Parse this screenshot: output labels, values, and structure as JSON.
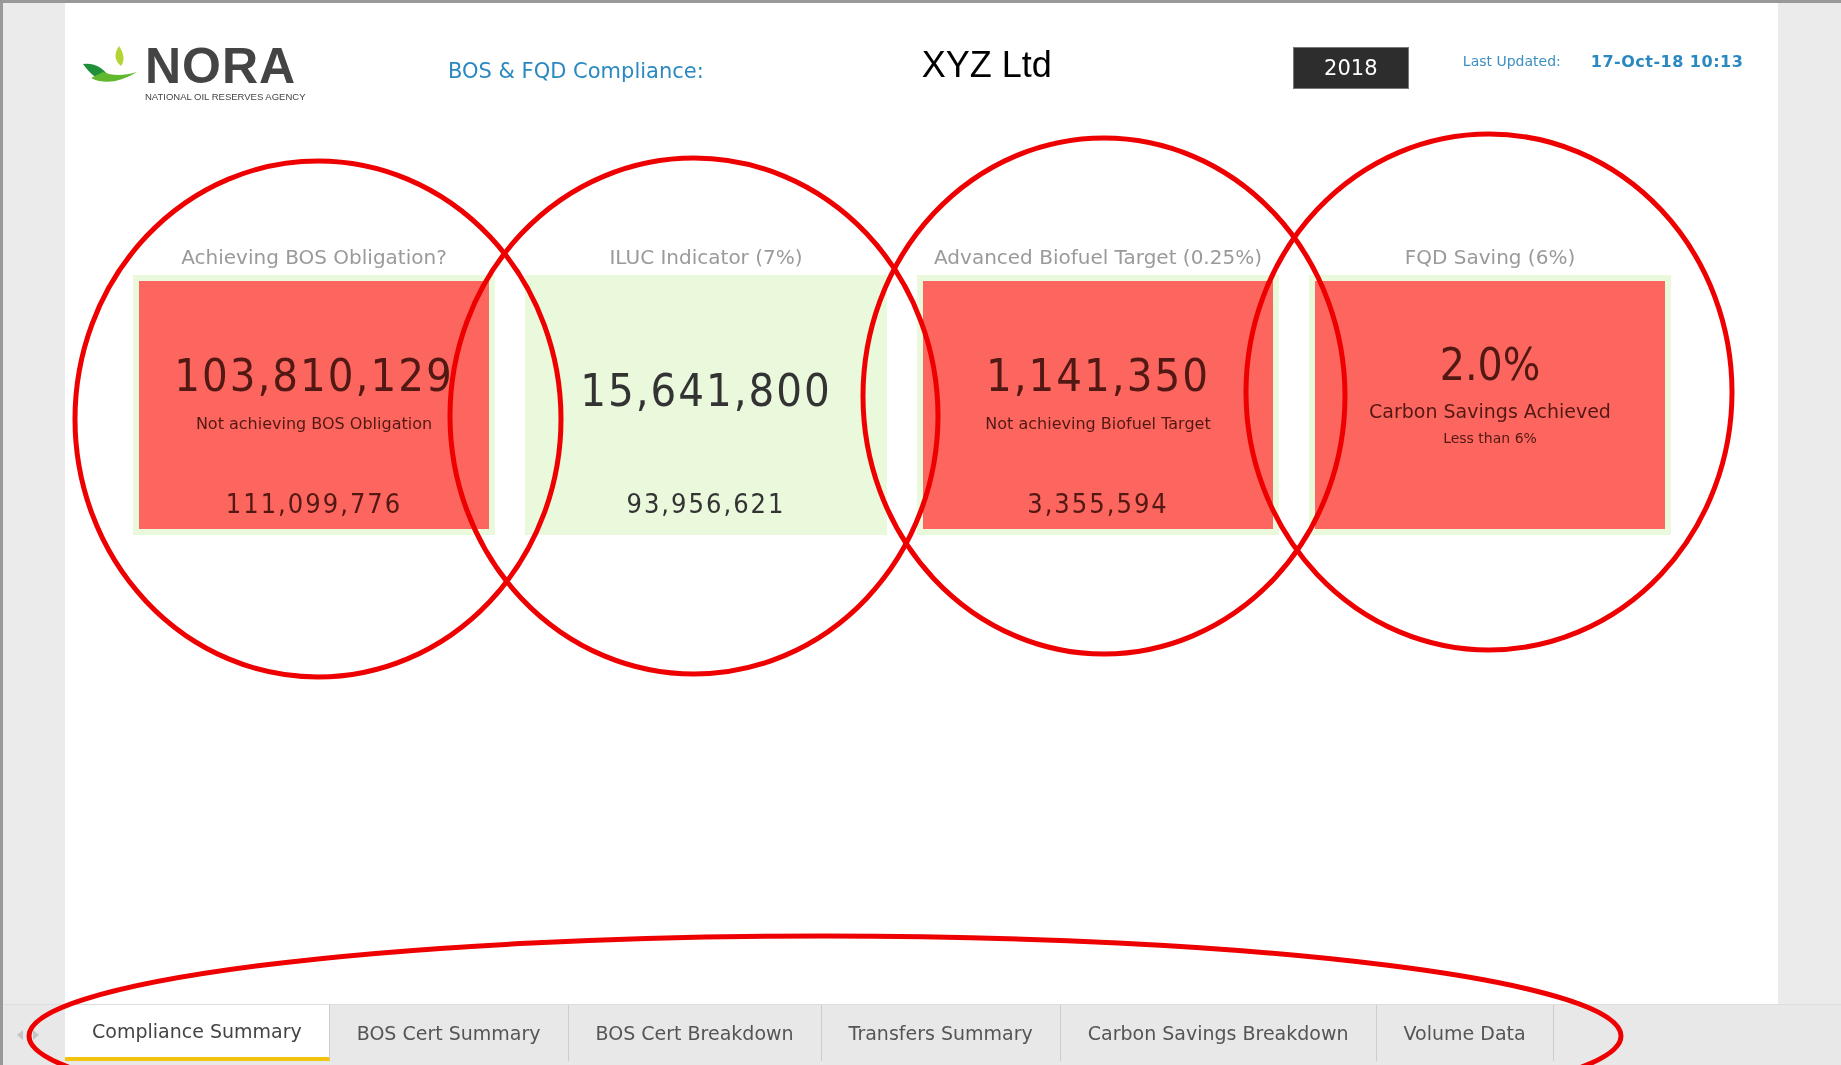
{
  "header": {
    "title": "BOS & FQD Compliance:",
    "company": "XYZ Ltd",
    "year": "2018",
    "updated_label": "Last Updated:",
    "updated_value": "17-Oct-18 10:13"
  },
  "logo": {
    "name": "NORA",
    "tagline": "NATIONAL OIL RESERVES AGENCY"
  },
  "cards": [
    {
      "kind": "standard",
      "title": "Achieving BOS Obligation?",
      "color": "#fd665e",
      "value": "103,810,129",
      "note": "Not achieving BOS Obligation",
      "footer": "111,099,776"
    },
    {
      "kind": "standard",
      "title": "ILUC Indicator (7%)",
      "color": "#eaf8dc",
      "value": "15,641,800",
      "footer": "93,956,621"
    },
    {
      "kind": "standard",
      "title": "Advanced Biofuel Target (0.25%)",
      "color": "#fd665e",
      "value": "1,141,350",
      "note": "Not achieving Biofuel Target",
      "footer": "3,355,594"
    },
    {
      "kind": "percent",
      "title": "FQD Saving (6%)",
      "color": "#fd665e",
      "value": "2.0%",
      "note": "Carbon Savings Achieved",
      "subnote": "Less than 6%"
    }
  ],
  "tabs": [
    {
      "label": "Compliance Summary",
      "selected": true
    },
    {
      "label": "BOS Cert Summary",
      "selected": false
    },
    {
      "label": "BOS Cert Breakdown",
      "selected": false
    },
    {
      "label": "Transfers Summary",
      "selected": false
    },
    {
      "label": "Carbon Savings Breakdown",
      "selected": false
    },
    {
      "label": "Volume Data",
      "selected": false
    }
  ]
}
